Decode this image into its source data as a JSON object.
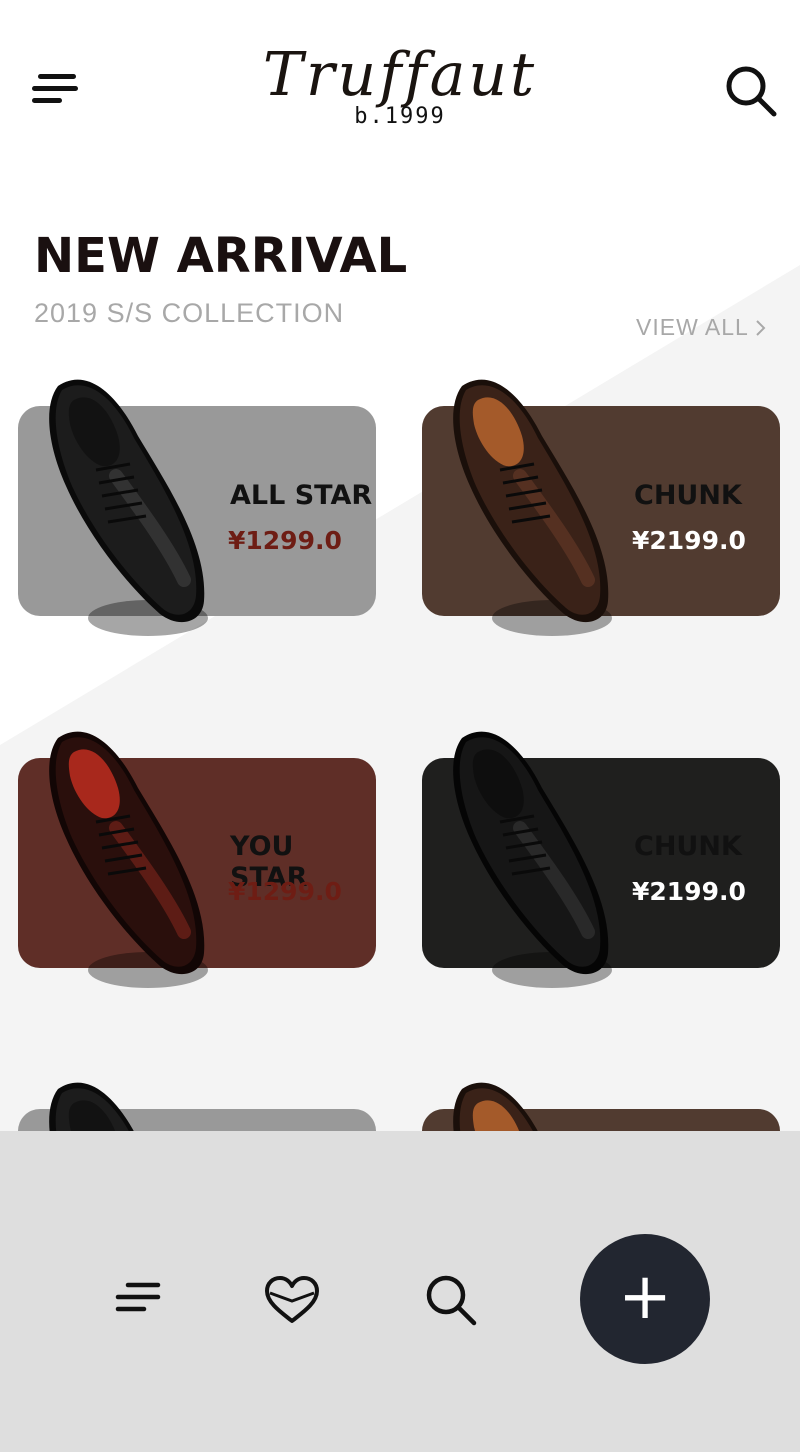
{
  "header": {
    "brand_name": "Truffaut",
    "brand_sub": "b.1999",
    "menu_icon": "menu-lines-icon",
    "search_icon": "search-icon"
  },
  "section": {
    "title": "NEW ARRIVAL",
    "subtitle": "2019 S/S  COLLECTION",
    "view_all": "VIEW ALL",
    "view_all_icon": "chevron-right-icon"
  },
  "products": [
    {
      "name": "ALL STAR",
      "price": "¥1299.0",
      "card_color": "#999999",
      "price_color": "#6e1d14",
      "name_color": "#111111",
      "shoe": "black-cap-toe-oxford"
    },
    {
      "name": "CHUNK",
      "price": "¥2199.0",
      "card_color": "#513b30",
      "price_color": "#ffffff",
      "name_color": "#111111",
      "shoe": "brown-wingtip-oxford"
    },
    {
      "name": "YOU STAR",
      "price": "¥1299.0",
      "card_color": "#5f2e27",
      "price_color": "#6e1d14",
      "name_color": "#111111",
      "shoe": "burgundy-cap-toe-oxford"
    },
    {
      "name": "CHUNK",
      "price": "¥2199.0",
      "card_color": "#1f1f1e",
      "price_color": "#ffffff",
      "name_color": "#111111",
      "shoe": "black-wingtip-oxford"
    },
    {
      "name": "",
      "price": "",
      "card_color": "#999999",
      "shoe": "black-cap-toe-oxford"
    },
    {
      "name": "",
      "price": "",
      "card_color": "#513b30",
      "shoe": "brown-wingtip-oxford"
    }
  ],
  "bottom_nav": {
    "items": [
      {
        "icon": "menu-lines-icon"
      },
      {
        "icon": "heart-icon"
      },
      {
        "icon": "search-icon"
      }
    ],
    "fab_label": "+",
    "fab_icon": "plus-icon",
    "bar_color": "#dedede",
    "fab_color": "#222630"
  }
}
